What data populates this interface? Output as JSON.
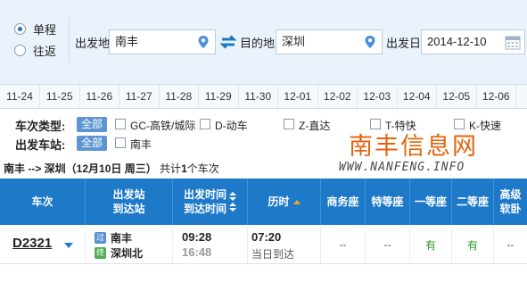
{
  "search": {
    "trip_options": [
      {
        "label": "单程",
        "checked": true
      },
      {
        "label": "往返",
        "checked": false
      }
    ],
    "from_label": "出发地",
    "from_value": "南丰",
    "to_label": "目的地",
    "to_value": "深圳",
    "date_label": "出发日",
    "date_value": "2014-12-10"
  },
  "dates": [
    "11-24",
    "11-25",
    "11-26",
    "11-27",
    "11-28",
    "11-29",
    "11-30",
    "12-01",
    "12-02",
    "12-03",
    "12-04",
    "12-05",
    "12-06"
  ],
  "filters": {
    "type_label": "车次类型:",
    "station_label": "出发车站:",
    "all_label": "全部",
    "types": [
      "GC-高铁/城际",
      "D-动车",
      "Z-直达",
      "T-特快",
      "K-快速"
    ],
    "stations": [
      "南丰"
    ]
  },
  "watermark": {
    "cn": "南丰信息网",
    "en": "WWW.NANFENG.INFO"
  },
  "summary": {
    "route": "南丰 --> 深圳（12月10日  周三）",
    "count_prefix": "共计",
    "count": "1",
    "count_suffix": "个车次"
  },
  "table": {
    "headers": {
      "train": "车次",
      "stations_1": "出发站",
      "stations_2": "到达站",
      "times_1": "出发时间",
      "times_2": "到达时间",
      "duration": "历时",
      "business": "商务座",
      "special": "特等座",
      "first": "一等座",
      "second": "二等座",
      "soft_1": "高级",
      "soft_2": "软卧"
    },
    "rows": [
      {
        "train": "D2321",
        "from_badge": "过",
        "from_station": "南丰",
        "to_badge": "终",
        "to_station": "深圳北",
        "depart": "09:28",
        "arrive": "16:48",
        "duration": "07:20",
        "duration_note": "当日到达",
        "business": "--",
        "special": "--",
        "first": "有",
        "second": "有",
        "soft": "--"
      }
    ]
  },
  "colors": {
    "header_blue": "#1e7ac9",
    "available_green": "#2a9a2a",
    "watermark_orange": "#e4630d",
    "all_button": "#5d95d3"
  }
}
